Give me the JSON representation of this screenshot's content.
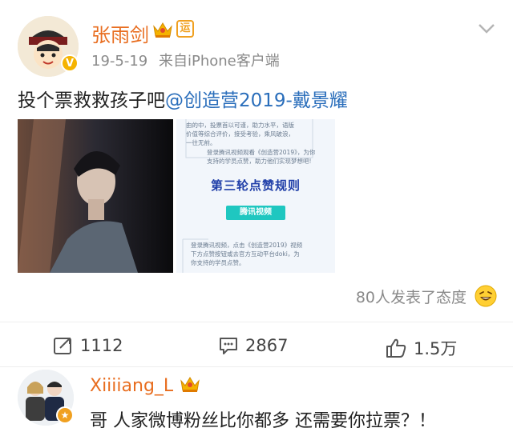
{
  "post": {
    "username": "张雨剑",
    "vip_label": "运",
    "badge_label": "V",
    "date": "19-5-19",
    "source": "来自iPhone客户端",
    "text": "投个票救救孩子吧",
    "mention": "@创造营2019-戴景耀",
    "image_right": {
      "lines_top": [
        "由的中，投票首以可谨，助力水平，语版",
        "价值等综合评价，接受考验，乘风破浪，",
        "一往无前。"
      ],
      "instruction_1": [
        "登录腾讯视频观看《创造营2019》，为你",
        "支持的学员点赞，助力他们实现梦想吧!"
      ],
      "heading": "第三轮点赞规则",
      "button_label": "腾讯视频",
      "instruction_2": [
        "登录腾讯视频，点击《创造营2019》视频",
        "下方点赞按钮或去官方互动平台doki，为",
        "你支持的学员点赞。"
      ]
    },
    "reactions_text": "80人发表了态度"
  },
  "actions": {
    "repost_count": "1112",
    "comment_count": "2867",
    "like_count": "1.5万"
  },
  "comment": {
    "username": "Xiiiiang_L",
    "badge_label": "★",
    "text": "哥 人家微博粉丝比你都多 还需要你拉票？！"
  },
  "colors": {
    "username": "#e86d1f",
    "mention": "#2a6ebb",
    "meta": "#8a8a8a",
    "vip": "#f0a020"
  }
}
